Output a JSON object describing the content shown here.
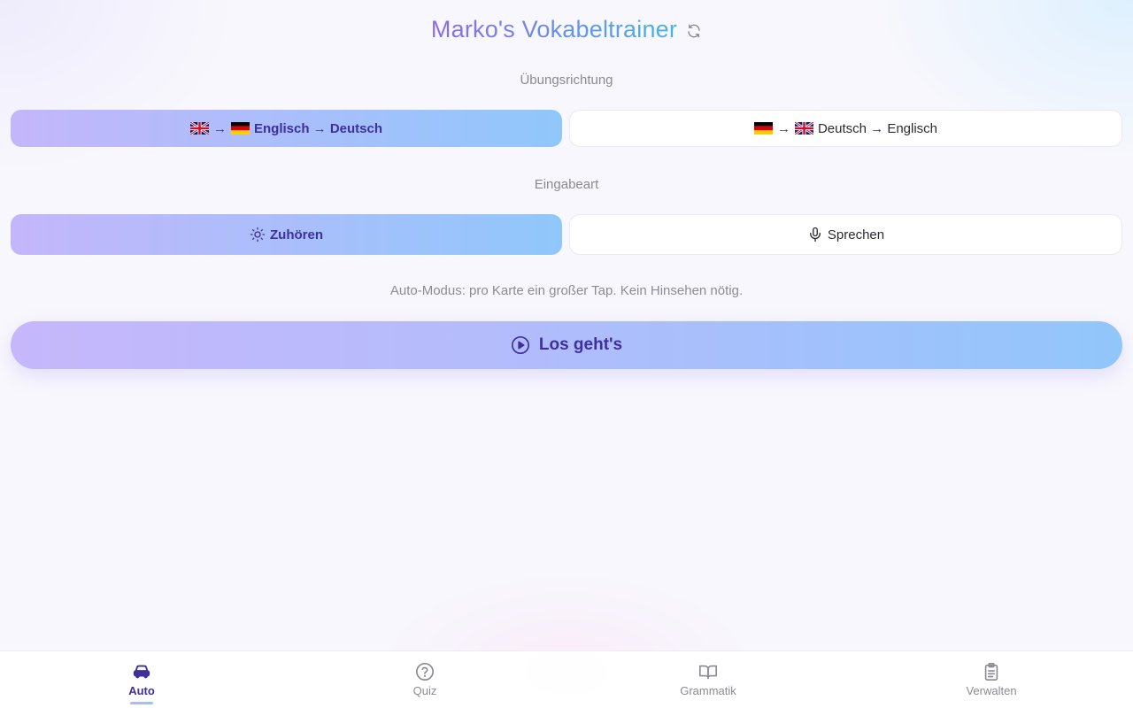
{
  "header": {
    "title": "Marko's Vokabeltrainer"
  },
  "direction": {
    "label": "Übungsrichtung",
    "options": [
      {
        "text": "Englisch → Deutsch",
        "active": true
      },
      {
        "text": "Deutsch → Englisch",
        "active": false
      }
    ]
  },
  "input_mode": {
    "label": "Eingabeart",
    "options": [
      {
        "text": "Zuhören",
        "active": true
      },
      {
        "text": "Sprechen",
        "active": false
      }
    ]
  },
  "hint": "Auto-Modus: pro Karte ein großer Tap. Kein Hinsehen nötig.",
  "start_button": "Los geht's",
  "nav": {
    "items": [
      {
        "label": "Auto",
        "icon": "car-icon",
        "active": true
      },
      {
        "label": "Quiz",
        "icon": "question-circle-icon",
        "active": false
      },
      {
        "label": "Grammatik",
        "icon": "book-open-icon",
        "active": false
      },
      {
        "label": "Verwalten",
        "icon": "clipboard-icon",
        "active": false
      }
    ]
  },
  "colors": {
    "accent_text": "#3e2f9c",
    "gradient_start": "#c4b6fb",
    "gradient_end": "#90c7fb"
  }
}
